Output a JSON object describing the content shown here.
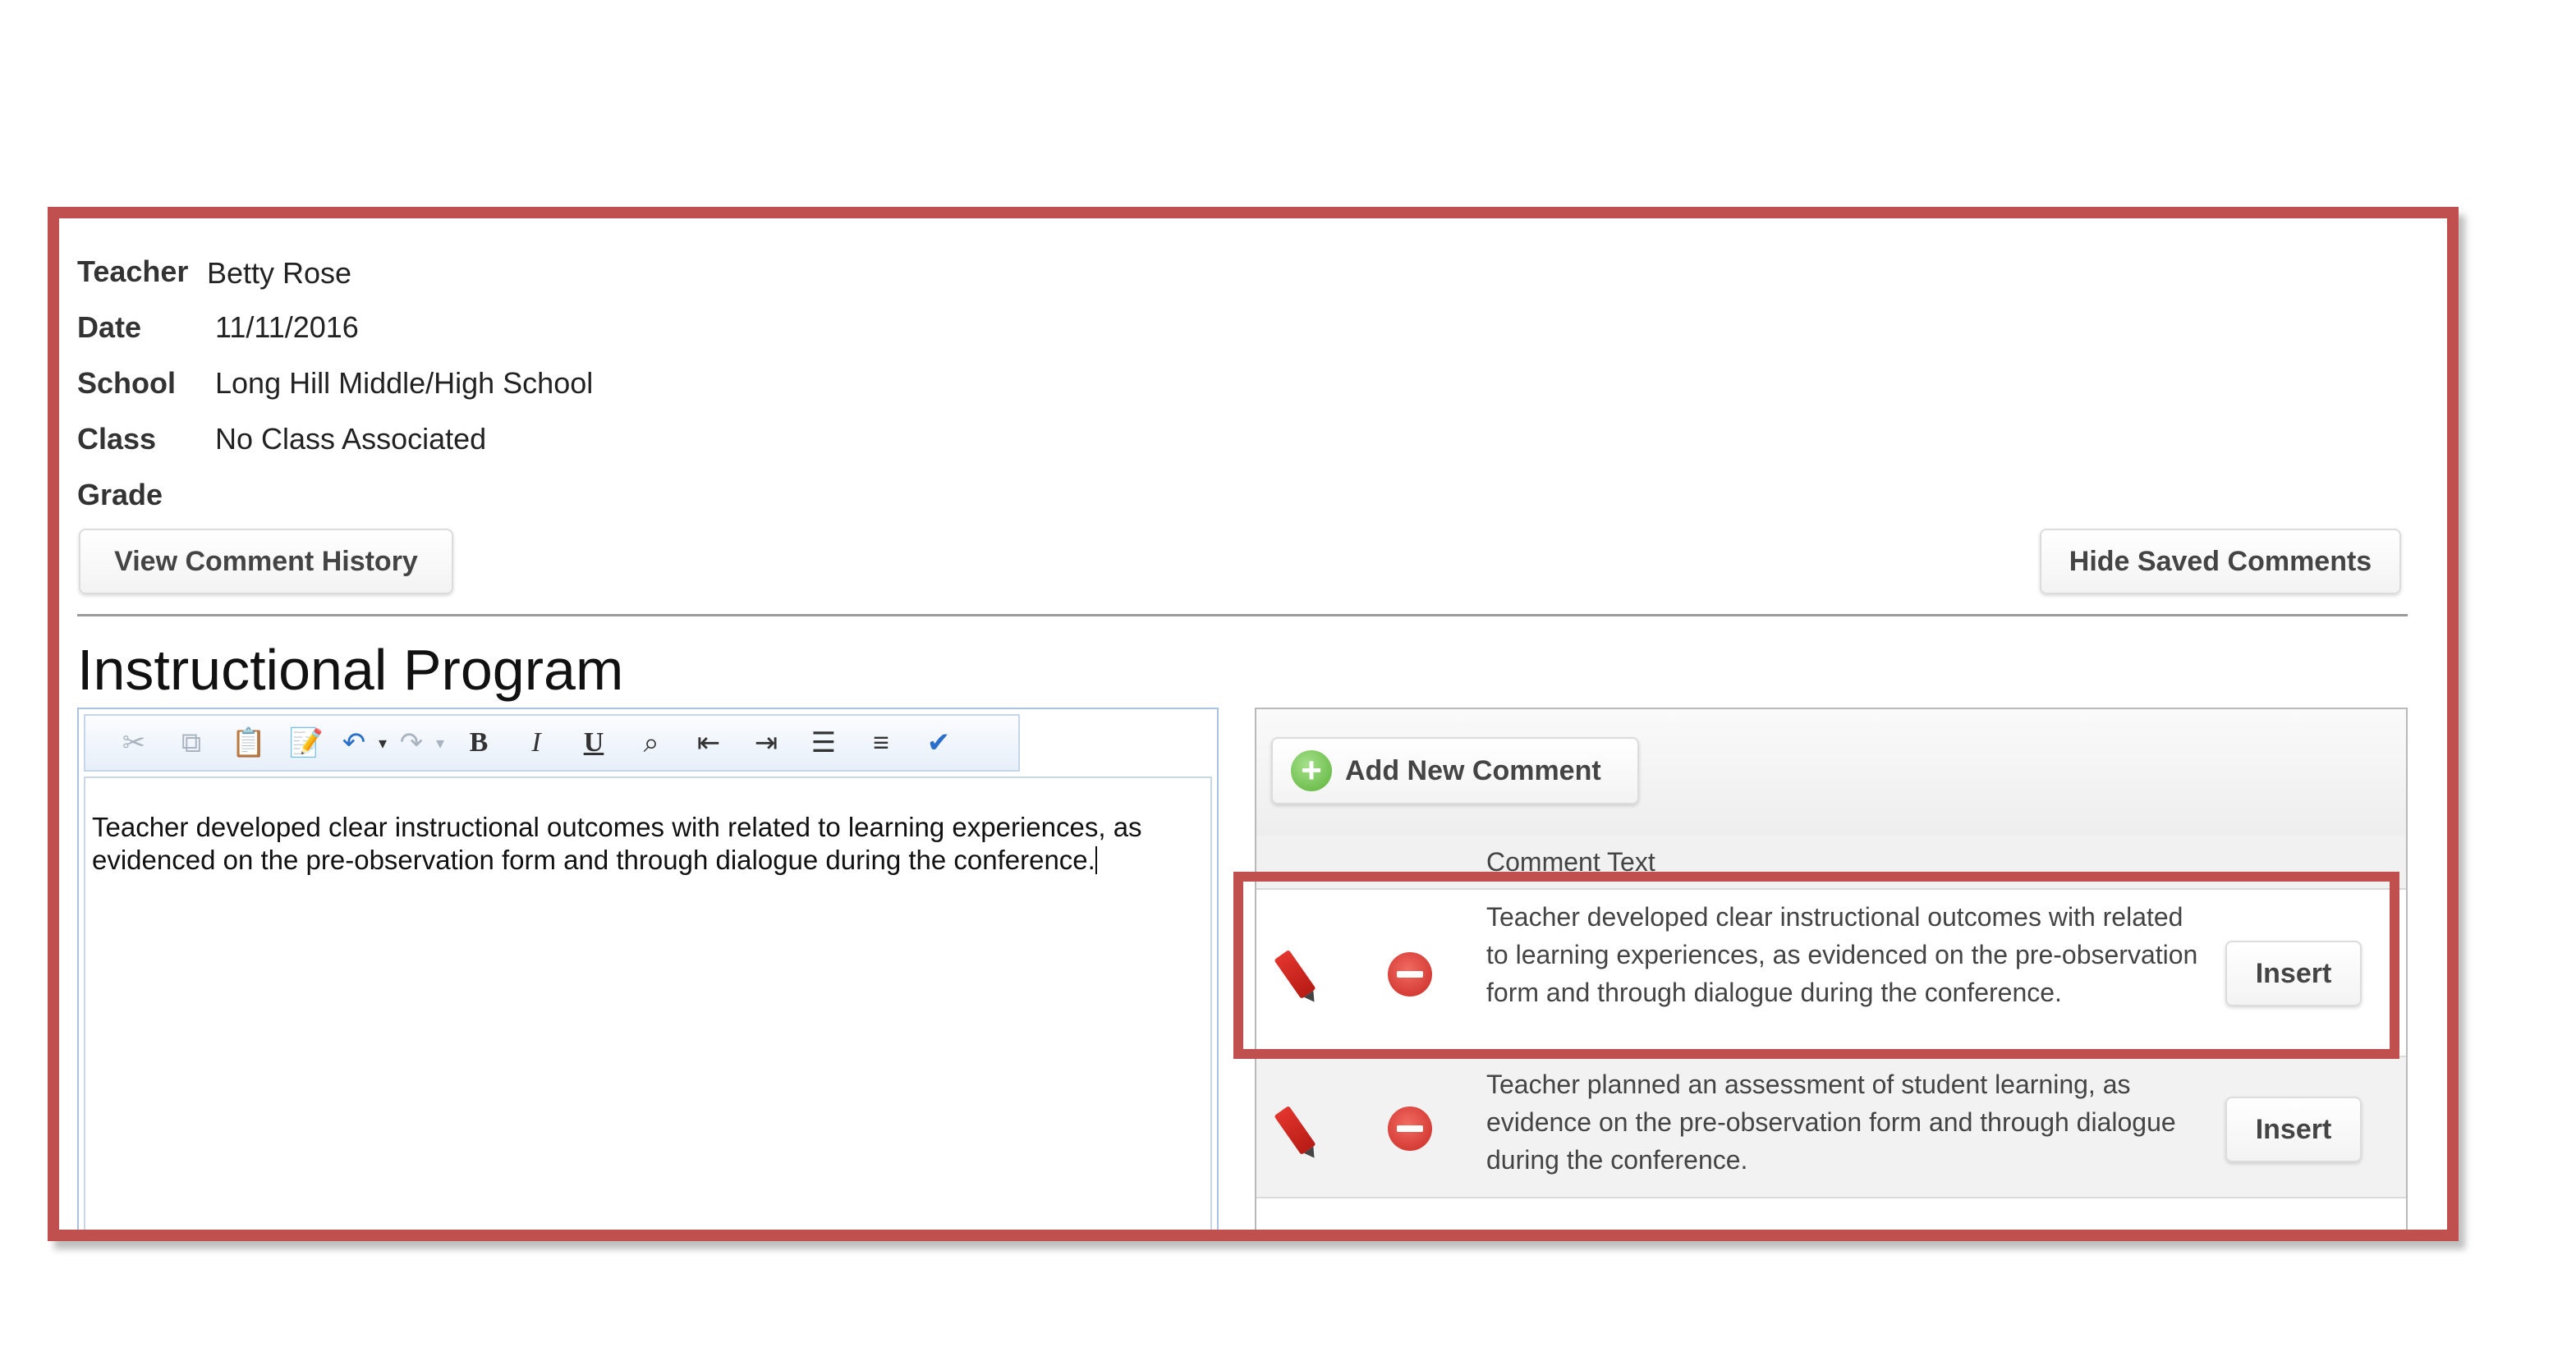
{
  "fields": {
    "teacher_label": "Teacher",
    "teacher_value": "Betty Rose",
    "date_label": "Date",
    "date_value": "11/11/2016",
    "school_label": "School",
    "school_value": "Long Hill Middle/High School",
    "class_label": "Class",
    "class_value": "No Class Associated",
    "grade_label": "Grade",
    "grade_value": ""
  },
  "buttons": {
    "view_history": "View Comment History",
    "hide_saved": "Hide Saved Comments"
  },
  "section": {
    "title": "Instructional Program"
  },
  "editor": {
    "toolbar_icons": [
      "cut-icon",
      "copy-icon",
      "paste-icon",
      "paste-word-icon",
      "undo-icon",
      "undo-dropdown-icon",
      "redo-icon",
      "redo-dropdown-icon",
      "bold-icon",
      "italic-icon",
      "underline-icon",
      "find-icon",
      "outdent-icon",
      "indent-icon",
      "bulleted-list-icon",
      "numbered-list-icon",
      "spellcheck-icon"
    ],
    "text": "Teacher developed clear instructional outcomes with related to learning experiences, as evidenced on the pre-observation form and through dialogue during the conference."
  },
  "comments": {
    "add_label": "Add New Comment",
    "column_header": "Comment Text",
    "insert_label": "Insert",
    "rows": [
      {
        "text": "Teacher developed clear instructional outcomes with related to learning experiences, as evidenced on the pre-observation form and through dialogue during the conference."
      },
      {
        "text": "Teacher planned an assessment of student learning, as evidence on the pre-observation form and through dialogue during the conference."
      }
    ]
  },
  "colors": {
    "highlight": "#c0504d",
    "editor_border": "#a9c1e3"
  }
}
